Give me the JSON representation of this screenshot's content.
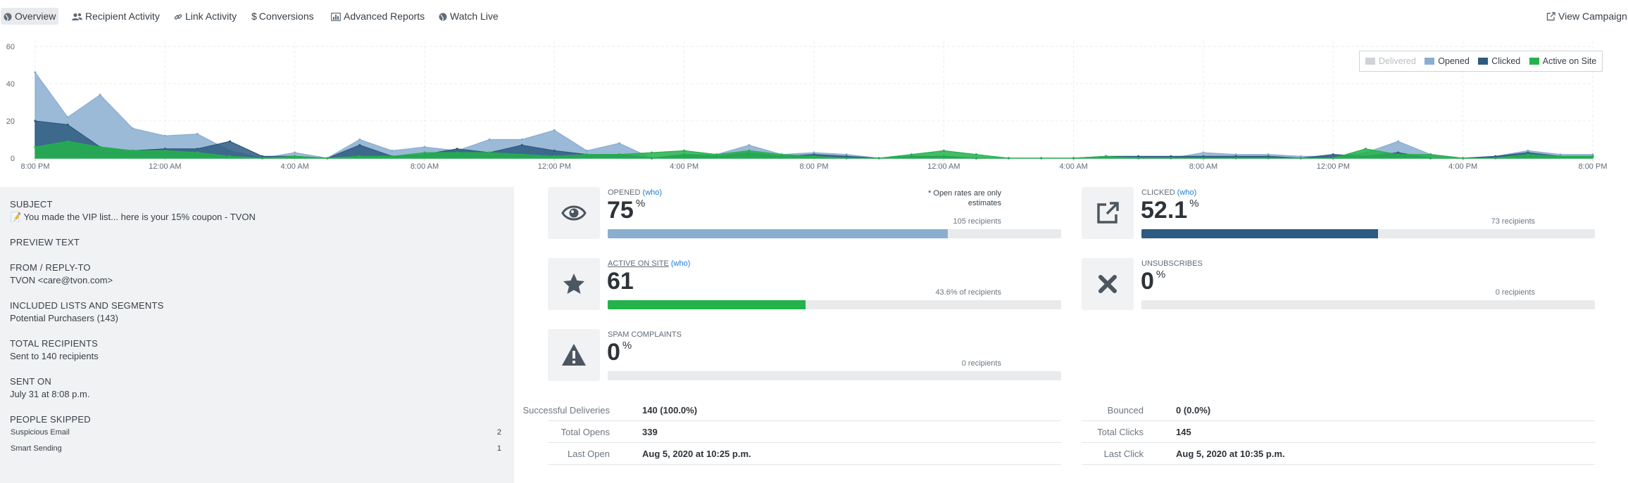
{
  "nav": {
    "tabs": [
      {
        "label": "Overview",
        "icon": "globe-icon"
      },
      {
        "label": "Recipient Activity",
        "icon": "users-icon"
      },
      {
        "label": "Link Activity",
        "icon": "link-icon"
      },
      {
        "label": "Conversions",
        "icon": "dollar-icon"
      },
      {
        "label": "Advanced Reports",
        "icon": "report-icon"
      },
      {
        "label": "Watch Live",
        "icon": "globe-icon"
      }
    ],
    "view_campaign": "View Campaign"
  },
  "chart_data": {
    "type": "area",
    "ylim": [
      0,
      60
    ],
    "yticks": [
      "0",
      "20",
      "40",
      "60"
    ],
    "xticks": [
      "8:00 PM",
      "12:00 AM",
      "4:00 AM",
      "8:00 AM",
      "12:00 PM",
      "4:00 PM",
      "8:00 PM",
      "12:00 AM",
      "4:00 AM",
      "8:00 AM",
      "12:00 PM",
      "4:00 PM",
      "8:00 PM"
    ],
    "legend_position": "top-right",
    "series": [
      {
        "name": "Delivered",
        "color": "#cfd3d7",
        "disabled": true,
        "values": []
      },
      {
        "name": "Opened",
        "color": "#8aaed0",
        "values": [
          46,
          22,
          34,
          16,
          12,
          13,
          4,
          0,
          3,
          0,
          10,
          4,
          6,
          4,
          10,
          10,
          15,
          4,
          8,
          0,
          2,
          2,
          7,
          2,
          3,
          2,
          0,
          1,
          1,
          0,
          0,
          0,
          0,
          1,
          0,
          0,
          3,
          2,
          2,
          1,
          1,
          3,
          9,
          2,
          0,
          1,
          4,
          2,
          2
        ]
      },
      {
        "name": "Clicked",
        "color": "#2d5a80",
        "values": [
          20,
          18,
          6,
          4,
          5,
          5,
          9,
          1,
          1,
          0,
          7,
          1,
          2,
          5,
          3,
          7,
          4,
          2,
          2,
          0,
          2,
          1,
          3,
          1,
          2,
          1,
          0,
          1,
          1,
          0,
          0,
          0,
          0,
          1,
          1,
          1,
          1,
          1,
          1,
          0,
          2,
          1,
          3,
          0,
          0,
          1,
          3,
          1,
          1
        ]
      },
      {
        "name": "Active on Site",
        "color": "#23b24b",
        "values": [
          6,
          9,
          6,
          4,
          4,
          3,
          1,
          0,
          1,
          0,
          1,
          1,
          3,
          3,
          3,
          2,
          1,
          2,
          2,
          3,
          4,
          2,
          4,
          2,
          1,
          0,
          0,
          2,
          4,
          2,
          0,
          0,
          0,
          1,
          0,
          0,
          0,
          0,
          0,
          0,
          0,
          5,
          2,
          2,
          0,
          0,
          2,
          1,
          1
        ]
      }
    ]
  },
  "subject": {
    "subject_label": "SUBJECT",
    "subject_value": "📝 You made the VIP list... here is your 15% coupon - TVON",
    "preview_label": "PREVIEW TEXT",
    "from_label": "FROM / REPLY-TO",
    "from_value": "TVON <care@tvon.com>",
    "lists_label": "INCLUDED LISTS AND SEGMENTS",
    "lists_value": "Potential Purchasers (143)",
    "total_label": "TOTAL RECIPIENTS",
    "total_value": "Sent to 140 recipients",
    "sent_label": "SENT ON",
    "sent_value": "July 31 at 8:08 p.m.",
    "skipped_label": "PEOPLE SKIPPED",
    "skipped": [
      {
        "label": "Suspicious Email",
        "count": "2"
      },
      {
        "label": "Smart Sending",
        "count": "1"
      }
    ]
  },
  "cards": {
    "opened": {
      "title": "OPENED",
      "who": "(who)",
      "value": "75",
      "unit": "%",
      "note": "* Open rates are only estimates",
      "sub": "105 recipients",
      "fraction": 0.75,
      "color": "#8aaed0",
      "icon": "eye-icon"
    },
    "clicked": {
      "title": "CLICKED",
      "who": "(who)",
      "value": "52.1",
      "unit": "%",
      "sub": "73 recipients",
      "fraction": 0.521,
      "color": "#2d5a80",
      "icon": "external-link-icon"
    },
    "active": {
      "title": "ACTIVE ON SITE",
      "who": "(who)",
      "value": "61",
      "sub": "43.6% of recipients",
      "fraction": 0.436,
      "color": "#23b24b",
      "icon": "star-icon"
    },
    "unsub": {
      "title": "UNSUBSCRIBES",
      "value": "0",
      "unit": "%",
      "sub": "0 recipients",
      "fraction": 0,
      "color": "#2d5a80",
      "icon": "x-icon"
    },
    "spam": {
      "title": "SPAM COMPLAINTS",
      "value": "0",
      "unit": "%",
      "sub": "0 recipients",
      "fraction": 0,
      "color": "#2d5a80",
      "icon": "warning-icon"
    }
  },
  "stats": {
    "left": [
      {
        "label": "Successful Deliveries",
        "value": "140 (100.0%)"
      },
      {
        "label": "Total Opens",
        "value": "339"
      },
      {
        "label": "Last Open",
        "value": "Aug 5, 2020 at 10:25 p.m."
      }
    ],
    "right": [
      {
        "label": "Bounced",
        "value": "0 (0.0%)"
      },
      {
        "label": "Total Clicks",
        "value": "145"
      },
      {
        "label": "Last Click",
        "value": "Aug 5, 2020 at 10:35 p.m."
      }
    ]
  }
}
